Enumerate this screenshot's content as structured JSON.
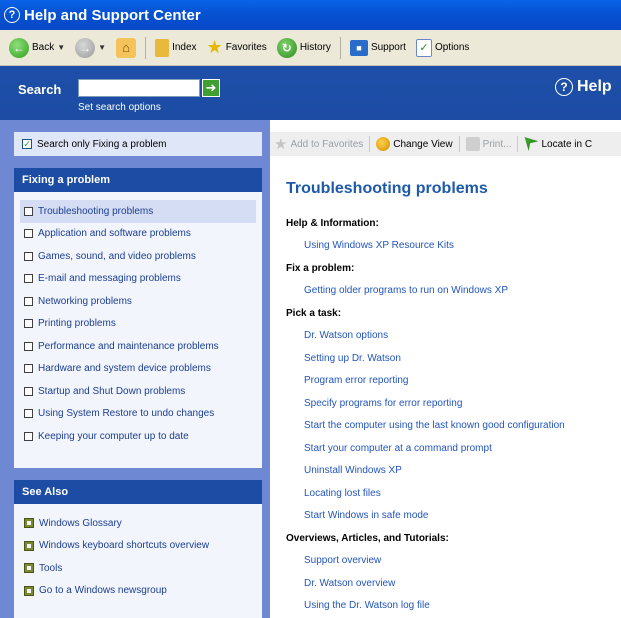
{
  "window": {
    "title": "Help and Support Center"
  },
  "toolbar": {
    "back_label": "Back",
    "index_label": "Index",
    "favorites_label": "Favorites",
    "history_label": "History",
    "support_label": "Support",
    "options_label": "Options"
  },
  "search": {
    "label": "Search",
    "options_link": "Set search options",
    "brand": "Help"
  },
  "filter": {
    "label": "Search only Fixing a problem",
    "checked": true
  },
  "fixing_panel": {
    "title": "Fixing a problem",
    "items": [
      {
        "label": "Troubleshooting problems"
      },
      {
        "label": "Application and software problems"
      },
      {
        "label": "Games, sound, and video problems"
      },
      {
        "label": "E-mail and messaging problems"
      },
      {
        "label": "Networking problems"
      },
      {
        "label": "Printing problems"
      },
      {
        "label": "Performance and maintenance problems"
      },
      {
        "label": "Hardware and system device problems"
      },
      {
        "label": "Startup and Shut Down problems"
      },
      {
        "label": "Using System Restore to undo changes"
      },
      {
        "label": "Keeping your computer up to date"
      }
    ]
  },
  "see_also": {
    "title": "See Also",
    "items": [
      {
        "label": "Windows Glossary"
      },
      {
        "label": "Windows keyboard shortcuts overview"
      },
      {
        "label": "Tools"
      },
      {
        "label": "Go to a Windows newsgroup"
      }
    ]
  },
  "content_toolbar": {
    "add_favorites": "Add to Favorites",
    "change_view": "Change View",
    "print": "Print...",
    "locate": "Locate in C"
  },
  "content": {
    "title": "Troubleshooting problems",
    "help_info_head": "Help & Information:",
    "help_info_links": [
      "Using Windows XP Resource Kits"
    ],
    "fix_head": "Fix a problem:",
    "fix_links": [
      "Getting older programs to run on Windows XP"
    ],
    "task_head": "Pick a task:",
    "task_links": [
      "Dr. Watson options",
      "Setting up Dr. Watson",
      "Program error reporting",
      "Specify programs for error reporting",
      "Start the computer using the last known good configuration",
      "Start your computer at a command prompt",
      "Uninstall Windows XP",
      "Locating lost files",
      "Start Windows in safe mode"
    ],
    "overview_head": "Overviews, Articles, and Tutorials:",
    "overview_links": [
      "Support overview",
      "Dr. Watson overview",
      "Using the Dr. Watson log file"
    ]
  },
  "colors": {
    "title_bar": "#0553d3",
    "nav_blue": "#1c4ca4",
    "left_pane": "#6e88d3",
    "link": "#2255bb",
    "heading": "#1e5aa8"
  }
}
